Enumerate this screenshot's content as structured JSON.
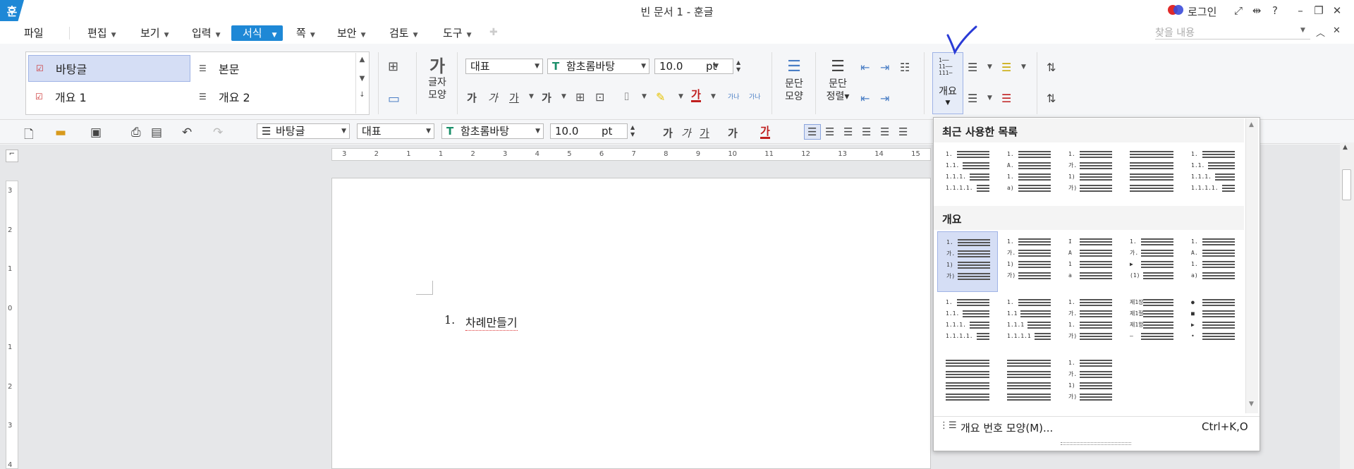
{
  "title_bar": {
    "logo": "훈",
    "title": "빈 문서 1 - 훈글",
    "login": "로그인",
    "icons": [
      "fullscreen-icon",
      "fit-icon",
      "help-icon",
      "minimize-icon",
      "restore-icon",
      "close-icon"
    ],
    "help": "?"
  },
  "menu": {
    "items": [
      {
        "label": "파일"
      },
      {
        "label": "편집"
      },
      {
        "label": "보기"
      },
      {
        "label": "입력"
      },
      {
        "label": "서식"
      },
      {
        "label": "쪽"
      },
      {
        "label": "보안"
      },
      {
        "label": "검토"
      },
      {
        "label": "도구"
      }
    ],
    "search_placeholder": "찾을 내용"
  },
  "ribbon": {
    "styles": [
      "바탕글",
      "본문",
      "개요 1",
      "개요 2"
    ],
    "char_shape": "글자\n모양",
    "char_shape_l1": "글자",
    "char_shape_l2": "모양",
    "style_combo": "대표",
    "font_combo": "함초롬바탕",
    "size_combo": "10.0",
    "size_unit": "pt",
    "para_shape_l1": "문단",
    "para_shape_l2": "모양",
    "para_align_l1": "문단",
    "para_align_l2": "정렬",
    "outline_label": "개요",
    "fmt_chars": [
      "가",
      "가",
      "가",
      "가"
    ],
    "spacing_labels": [
      "가나",
      "가나"
    ]
  },
  "toolbar2": {
    "style_combo": "바탕글",
    "lang_combo": "대표",
    "font_combo": "함초롬바탕",
    "size_combo": "10.0",
    "size_unit": "pt",
    "fmt_chars": [
      "가",
      "가",
      "가",
      "가",
      "가"
    ]
  },
  "document": {
    "list_number": "1.",
    "list_text": "차례만들기",
    "ruler_numbers": [
      "3",
      "2",
      "1",
      "1",
      "2",
      "3",
      "4",
      "5",
      "6",
      "7",
      "8",
      "9",
      "10",
      "11",
      "12",
      "13",
      "14",
      "15"
    ],
    "vruler_numbers": [
      "3",
      "2",
      "1",
      "0",
      "1",
      "2",
      "3",
      "4"
    ]
  },
  "panel": {
    "recent_title": "최근 사용한 목록",
    "outline_title": "개요",
    "footer_label": "개요 번호 모양(M)...",
    "footer_shortcut": "Ctrl+K,O",
    "recent_thumbs": [
      [
        "1.",
        "1.1.",
        "1.1.1.",
        "1.1.1.1."
      ],
      [
        "1.",
        "A.",
        "1.",
        "a)"
      ],
      [
        "1.",
        "가.",
        "1)",
        "가)"
      ],
      [
        "",
        "",
        "",
        ""
      ],
      [
        "1.",
        "1.1.",
        "1.1.1.",
        "1.1.1.1."
      ]
    ],
    "outline_thumbs": [
      [
        "1.",
        "가.",
        "1)",
        "가)"
      ],
      [
        "1.",
        "가.",
        "1)",
        "가)"
      ],
      [
        "I",
        "A",
        "1",
        "a"
      ],
      [
        "1.",
        "가.",
        "▶",
        "(1)"
      ],
      [
        "1.",
        "A.",
        "1.",
        "a)"
      ],
      [
        "1.",
        "1.1.",
        "1.1.1.",
        "1.1.1.1."
      ],
      [
        "1.",
        "1.1",
        "1.1.1",
        "1.1.1.1"
      ],
      [
        "1.",
        "가.",
        "1.",
        "가)"
      ],
      [
        "제1장",
        "제1절",
        "제1항",
        "–"
      ],
      [
        "●",
        "■",
        "▶",
        "•"
      ],
      [
        "",
        "",
        "",
        ""
      ],
      [
        "",
        "",
        "",
        ""
      ],
      [
        "1.",
        "가.",
        "1)",
        "가)"
      ]
    ]
  },
  "colors": {
    "accent": "#1e88d6",
    "selection": "#d5def5",
    "login_red": "#e02a2a",
    "login_blue": "#3b4bd9",
    "check": "#2a3bd6"
  }
}
